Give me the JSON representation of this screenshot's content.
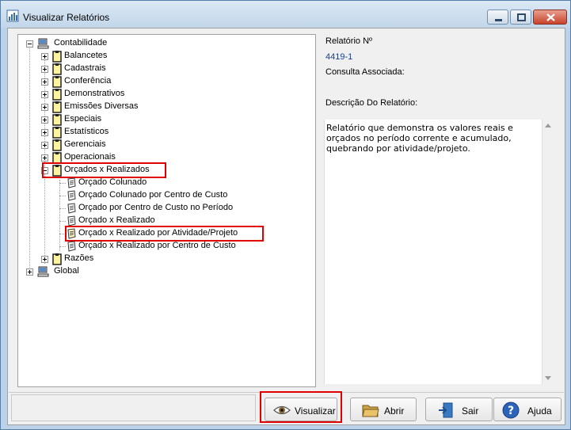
{
  "window": {
    "title": "Visualizar Relatórios"
  },
  "tree": {
    "root_contabilidade": "Contabilidade",
    "categories": [
      "Balancetes",
      "Cadastrais",
      "Conferência",
      "Demonstrativos",
      "Emissões Diversas",
      "Especiais",
      "Estatísticos",
      "Gerenciais",
      "Operacionais",
      "Orçados x Realizados"
    ],
    "orcados_children": [
      "Orçado Colunado",
      "Orçado Colunado por Centro de Custo",
      "Orçado por Centro de Custo no Período",
      "Orçado x Realizado",
      "Orçado x Realizado por Atividade/Projeto",
      "Orçado x Realizado por Centro de Custo"
    ],
    "razoes": "Razões",
    "root_global": "Global"
  },
  "info": {
    "report_number_label": "Relatório Nº",
    "report_number": "4419-1",
    "query_label": "Consulta Associada:",
    "description_label": "Descrição Do Relatório:",
    "description": "Relatório que demonstra os valores reais e orçados no período corrente e acumulado, quebrando por atividade/projeto."
  },
  "buttons": {
    "visualizar": "Visualizar",
    "abrir": "Abrir",
    "sair": "Sair",
    "ajuda": "Ajuda"
  },
  "colors": {
    "highlight": "#e00000",
    "accent_number": "#1a3d8a"
  }
}
